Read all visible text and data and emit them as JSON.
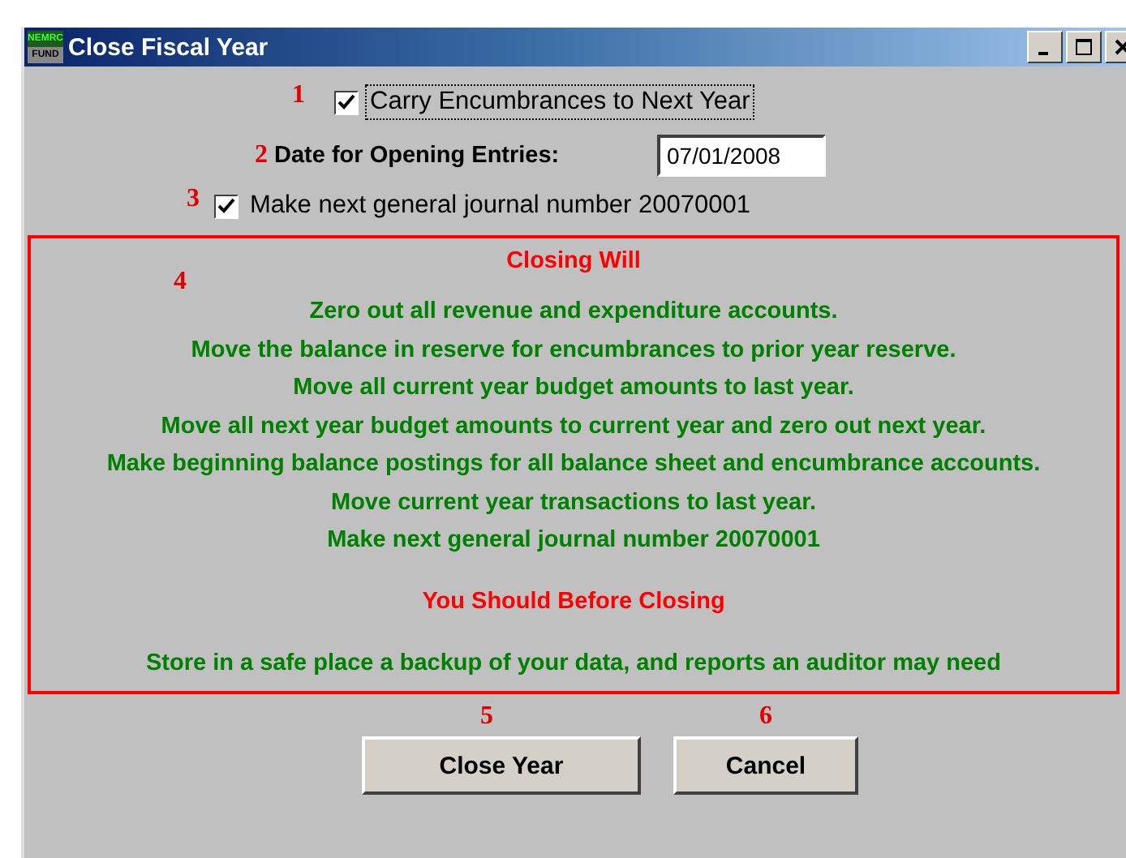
{
  "window": {
    "title": "Close Fiscal Year",
    "app_icon_top": "NEMRC",
    "app_icon_bottom": "FUND"
  },
  "options": [
    {
      "kind": "checkbox",
      "marker": "1",
      "label": "Carry Encumbrances to Next Year",
      "checked": true,
      "focused": true
    },
    {
      "kind": "date",
      "marker": "2",
      "label": "Date for Opening Entries:",
      "value": "07/01/2008"
    },
    {
      "kind": "checkbox",
      "marker": "3",
      "label": "Make next general journal number 20070001",
      "checked": true,
      "focused": false
    }
  ],
  "summary": {
    "marker": "4",
    "lines": [
      {
        "kind": "heading",
        "text": "Closing Will"
      },
      {
        "kind": "item",
        "text": "Zero out all revenue and expenditure accounts."
      },
      {
        "kind": "item",
        "text": "Move the balance in reserve for encumbrances to prior year reserve."
      },
      {
        "kind": "item",
        "text": "Move all current year budget amounts to last year."
      },
      {
        "kind": "item",
        "text": "Move all next year budget amounts to current year and zero out next year."
      },
      {
        "kind": "item",
        "text": "Make beginning balance postings for all balance sheet and encumbrance accounts."
      },
      {
        "kind": "item",
        "text": "Move current year transactions to last year."
      },
      {
        "kind": "item",
        "text": "Make next general journal number 20070001"
      },
      {
        "kind": "heading",
        "text": "You Should Before Closing"
      },
      {
        "kind": "item",
        "text": "Store in a safe place a backup of your data, and reports an auditor may need"
      }
    ]
  },
  "buttons": [
    {
      "marker": "5",
      "label": "Close Year"
    },
    {
      "marker": "6",
      "label": "Cancel"
    }
  ]
}
